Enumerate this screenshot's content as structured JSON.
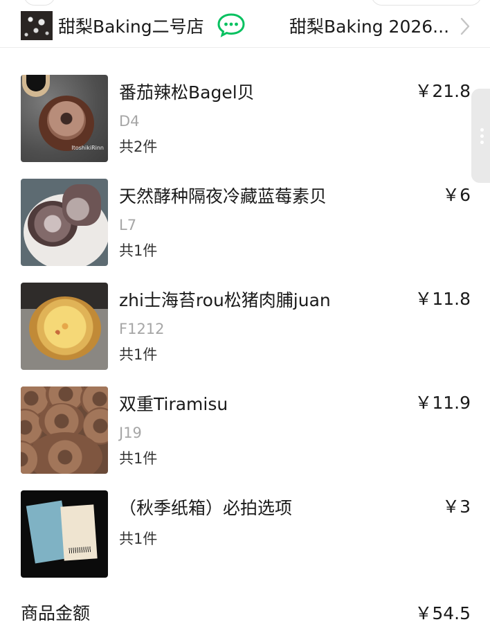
{
  "shop": {
    "name": "甜梨Baking二号店",
    "right_text": "甜梨Baking 2026..."
  },
  "items": [
    {
      "name": "番茄辣松Bagel贝",
      "code": "D4",
      "qty": "共2件",
      "price": "￥21.8"
    },
    {
      "name": "天然酵种隔夜冷藏蓝莓素贝",
      "code": "L7",
      "qty": "共1件",
      "price": "￥6"
    },
    {
      "name": "zhi士海苔rou松猪肉脯juan",
      "code": "F1212",
      "qty": "共1件",
      "price": "￥11.8"
    },
    {
      "name": "双重Tiramisu",
      "code": "J19",
      "qty": "共1件",
      "price": "￥11.9"
    },
    {
      "name": "（秋季纸箱）必拍选项",
      "code": "",
      "qty": "共1件",
      "price": "￥3"
    }
  ],
  "summary": {
    "label": "商品金额",
    "value": "￥54.5"
  },
  "colors": {
    "wechat_green": "#07c160",
    "muted_text": "#a6a6a6"
  },
  "icons": {
    "chat": "wechat-chat-icon",
    "chevron": "chevron-right-icon",
    "more": "more-vertical-icon"
  }
}
